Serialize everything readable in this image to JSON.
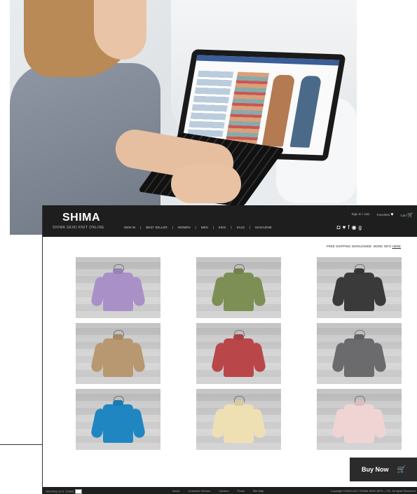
{
  "site": {
    "logo": "SHIMA",
    "logo_sub": "SHIMA SEIKI KNIT ONLINE",
    "nav": [
      "NEW IN",
      "BEST SELLER",
      "WOMEN",
      "MEN",
      "KIDS",
      "SALE",
      "MAGAZINE"
    ],
    "header_links": [
      "Sign In / Join",
      "Favorites",
      "Cart"
    ],
    "social_icons": [
      "instagram-icon",
      "twitter-icon",
      "facebook-icon",
      "pinterest-icon",
      "google-plus-icon"
    ],
    "shipping_text": "FREE SHIPPING WORLDWIDE. MORE INFO",
    "shipping_link": "HERE",
    "buy_now": "Buy Now",
    "footer": {
      "language": "Site/Shop (U.S. Dollar)",
      "links": [
        "About",
        "Customer Service",
        "Careers",
        "Press",
        "Site Map"
      ],
      "copyright": "Copyright ©2006-2017 SHIMA SEIKI MFG., LTD. All rights Reserved."
    }
  },
  "products": [
    {
      "color": "#a991c8"
    },
    {
      "color": "#7d8f55"
    },
    {
      "color": "#3a3a3a"
    },
    {
      "color": "#b79870"
    },
    {
      "color": "#b9474a"
    },
    {
      "color": "#6b6b6d"
    },
    {
      "color": "#1f86c1"
    },
    {
      "color": "#efe0b4"
    },
    {
      "color": "#f0d4d4"
    }
  ]
}
